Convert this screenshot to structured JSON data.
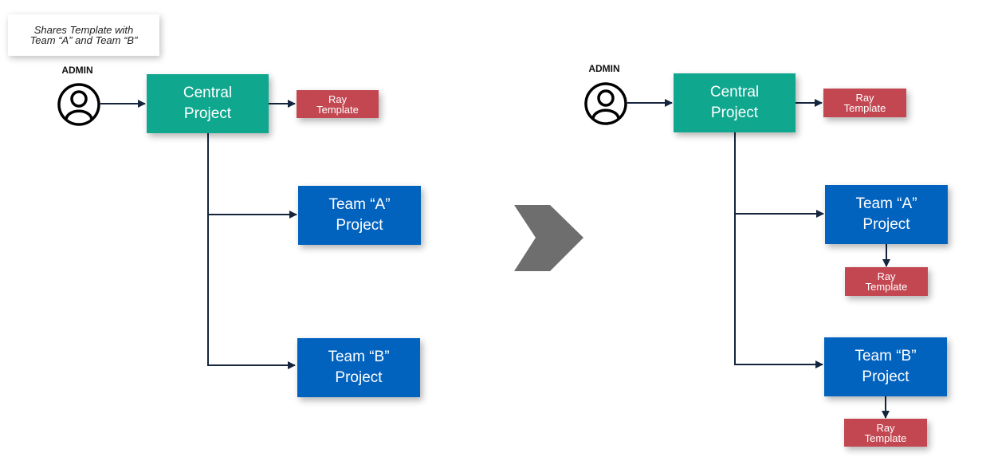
{
  "note": "Shares Template with\nTeam “A” and Team “B”",
  "admin": "ADMIN",
  "central": "Central\nProject",
  "ray": "Ray\nTemplate",
  "team_a": "Team “A”\nProject",
  "team_b": "Team “B”\nProject",
  "colors": {
    "central": "#0fa88f",
    "team": "#0263bf",
    "template": "#c34751",
    "connector": "#14253d",
    "transition_arrow": "#6e6e6e"
  }
}
